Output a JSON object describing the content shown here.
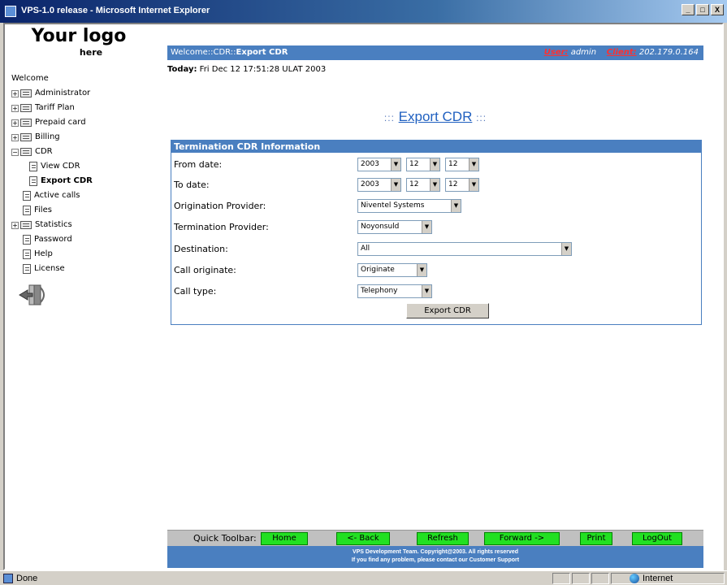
{
  "window": {
    "title": "VPS-1.0 release - Microsoft Internet Explorer",
    "min": "_",
    "max": "□",
    "close": "X"
  },
  "logo": {
    "line1": "Your logo",
    "line2": "here"
  },
  "tree": [
    {
      "label": "Welcome",
      "type": "plain"
    },
    {
      "label": "Administrator",
      "type": "folder"
    },
    {
      "label": "Tariff Plan",
      "type": "folder"
    },
    {
      "label": "Prepaid card",
      "type": "folder"
    },
    {
      "label": "Billing",
      "type": "folder"
    },
    {
      "label": "CDR",
      "type": "folder-open"
    },
    {
      "label": "View CDR",
      "type": "child"
    },
    {
      "label": "Export CDR",
      "type": "child-active"
    },
    {
      "label": "Active calls",
      "type": "leaf"
    },
    {
      "label": "Files",
      "type": "leaf"
    },
    {
      "label": "Statistics",
      "type": "folder"
    },
    {
      "label": "Password",
      "type": "leaf"
    },
    {
      "label": "Help",
      "type": "leaf"
    },
    {
      "label": "License",
      "type": "leaf"
    }
  ],
  "topbar": {
    "crumb": "Welcome::CDR::",
    "crumb_current": "Export CDR",
    "user_label": "User:",
    "user": "admin",
    "client_label": "Client:",
    "client": "202.179.0.164"
  },
  "today": {
    "label": "Today:",
    "value": "Fri Dec 12 17:51:28 ULAT 2003"
  },
  "heading": {
    "deco_left": ":::",
    "title": "Export CDR",
    "deco_right": ":::"
  },
  "form": {
    "title": "Termination CDR Information",
    "from_label": "From date:",
    "from": {
      "year": "2003",
      "month": "12",
      "day": "12"
    },
    "to_label": "To date:",
    "to": {
      "year": "2003",
      "month": "12",
      "day": "12"
    },
    "orig_provider_label": "Origination Provider:",
    "orig_provider": "Niventel Systems",
    "term_provider_label": "Termination Provider:",
    "term_provider": "Noyonsuld",
    "destination_label": "Destination:",
    "destination": "All",
    "call_originate_label": "Call originate:",
    "call_originate": "Originate",
    "call_type_label": "Call type:",
    "call_type": "Telephony",
    "submit": "Export CDR"
  },
  "toolbar": {
    "label": "Quick Toolbar:",
    "home": "Home",
    "back": "<- Back",
    "refresh": "Refresh",
    "forward": "Forward ->",
    "print": "Print",
    "logout": "LogOut"
  },
  "footer": {
    "line1": "VPS Development Team. Copyright@2003. All rights reserved",
    "line2": "If you find any problem, please contact our Customer Support"
  },
  "status": {
    "text": "Done",
    "zone": "Internet"
  },
  "colors": {
    "accent": "#4a7fc0",
    "button_green": "#22e022",
    "link_red": "#ff3030"
  }
}
